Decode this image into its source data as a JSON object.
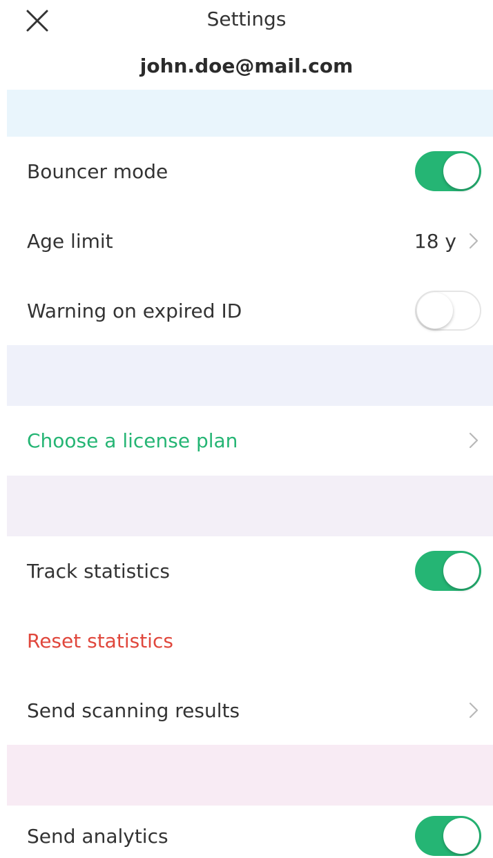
{
  "header": {
    "title": "Settings",
    "close_icon": "close-icon",
    "email": "john.doe@mail.com"
  },
  "colors": {
    "accent_green": "#25b574",
    "danger_red": "#e0473c",
    "band_blue": "#e9f5fc",
    "band_lavender": "#eff1fa",
    "band_lilac": "#f3eff7",
    "band_pink": "#f8ebf4"
  },
  "settings": {
    "bouncer_mode": {
      "label": "Bouncer mode",
      "enabled": true
    },
    "age_limit": {
      "label": "Age limit",
      "value": "18 y",
      "icon": "chevron-right-icon"
    },
    "warning_expired": {
      "label": "Warning on expired ID",
      "enabled": false
    },
    "license_plan": {
      "label": "Choose a license plan",
      "icon": "chevron-right-icon"
    },
    "track_statistics": {
      "label": "Track statistics",
      "enabled": true
    },
    "reset_statistics": {
      "label": "Reset statistics"
    },
    "send_scanning": {
      "label": "Send scanning results",
      "icon": "chevron-right-icon"
    },
    "send_analytics": {
      "label": "Send analytics",
      "enabled": true
    }
  }
}
